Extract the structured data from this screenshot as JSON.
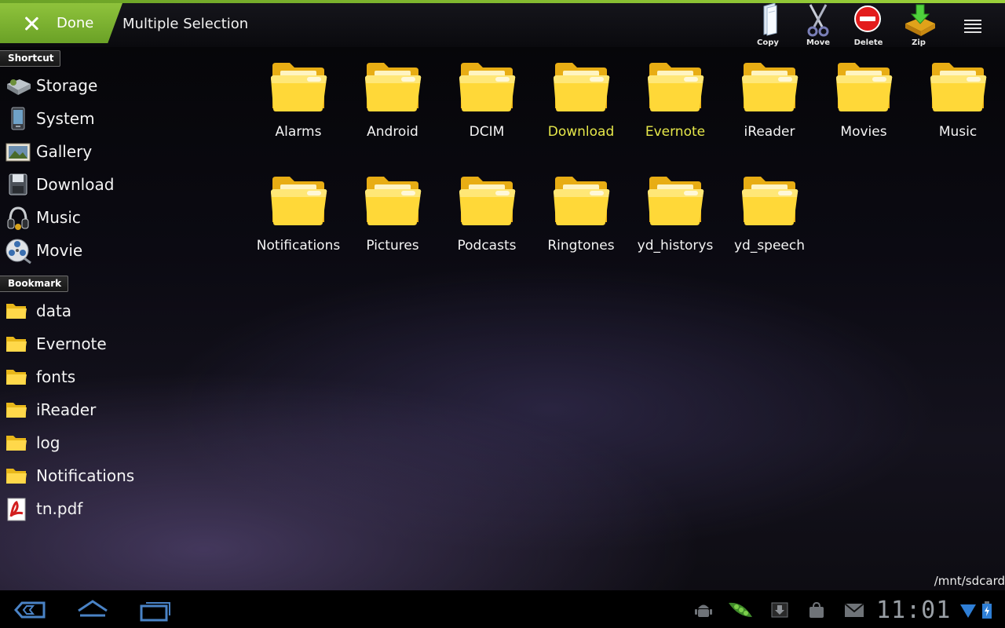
{
  "action_bar": {
    "done_label": "Done",
    "title": "Multiple Selection",
    "actions": [
      {
        "label": "Copy",
        "icon": "copy-icon"
      },
      {
        "label": "Move",
        "icon": "scissors-icon"
      },
      {
        "label": "Delete",
        "icon": "delete-icon"
      },
      {
        "label": "Zip",
        "icon": "zip-icon"
      }
    ],
    "menu_icon": "overflow-menu-icon"
  },
  "sidebar": {
    "shortcut_header": "Shortcut",
    "shortcuts": [
      {
        "label": "Storage",
        "icon": "storage-icon"
      },
      {
        "label": "System",
        "icon": "system-icon"
      },
      {
        "label": "Gallery",
        "icon": "gallery-icon"
      },
      {
        "label": "Download",
        "icon": "download-icon"
      },
      {
        "label": "Music",
        "icon": "headphones-icon"
      },
      {
        "label": "Movie",
        "icon": "film-reel-icon"
      }
    ],
    "bookmark_header": "Bookmark",
    "bookmarks": [
      {
        "label": "data",
        "icon": "folder-icon"
      },
      {
        "label": "Evernote",
        "icon": "folder-icon"
      },
      {
        "label": "fonts",
        "icon": "folder-icon"
      },
      {
        "label": "iReader",
        "icon": "folder-icon"
      },
      {
        "label": "log",
        "icon": "folder-icon"
      },
      {
        "label": "Notifications",
        "icon": "folder-icon"
      },
      {
        "label": "tn.pdf",
        "icon": "pdf-icon"
      }
    ]
  },
  "folders": [
    {
      "name": "Alarms",
      "selected": false
    },
    {
      "name": "Android",
      "selected": false
    },
    {
      "name": "DCIM",
      "selected": false
    },
    {
      "name": "Download",
      "selected": true
    },
    {
      "name": "Evernote",
      "selected": true
    },
    {
      "name": "iReader",
      "selected": false
    },
    {
      "name": "Movies",
      "selected": false
    },
    {
      "name": "Music",
      "selected": false
    },
    {
      "name": "Notifications",
      "selected": false
    },
    {
      "name": "Pictures",
      "selected": false
    },
    {
      "name": "Podcasts",
      "selected": false
    },
    {
      "name": "Ringtones",
      "selected": false
    },
    {
      "name": "yd_historys",
      "selected": false
    },
    {
      "name": "yd_speech",
      "selected": false
    }
  ],
  "current_path": "/mnt/sdcard",
  "system_bar": {
    "clock": "11:01",
    "nav": [
      "back-icon",
      "home-icon",
      "recent-apps-icon"
    ],
    "tray": [
      "android-debug-icon",
      "peapod-icon",
      "download-notification-icon",
      "bag-icon",
      "gmail-icon",
      "wifi-icon",
      "battery-icon"
    ]
  },
  "colors": {
    "accent_green": "#8fc33c",
    "selected_text": "#e6e84a"
  }
}
